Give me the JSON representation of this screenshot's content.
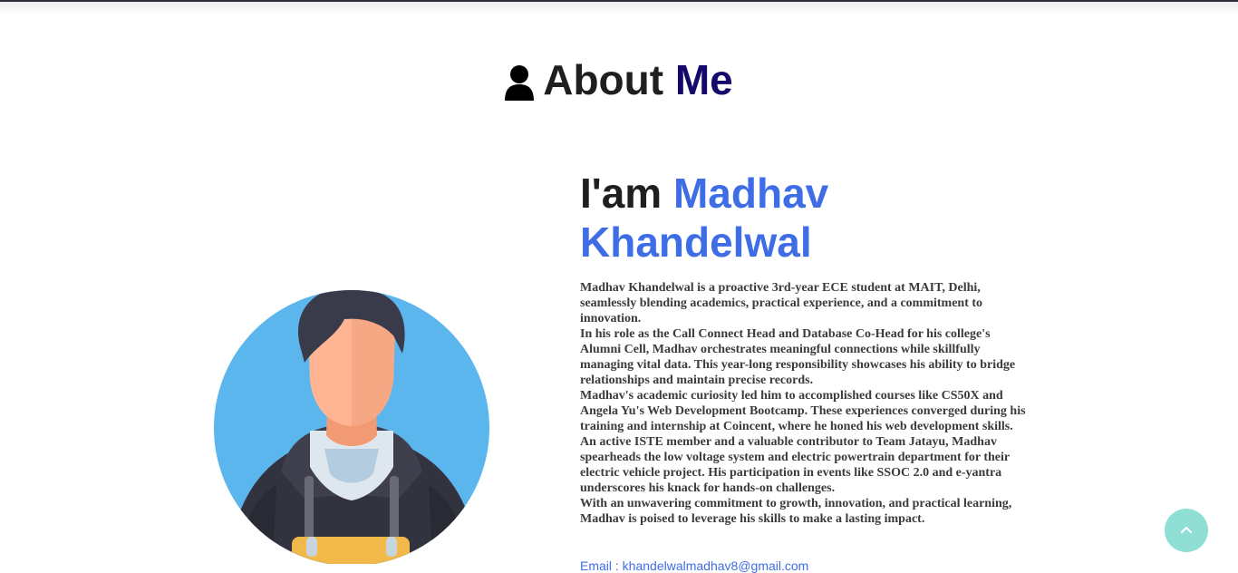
{
  "about": {
    "heading_prefix": "About",
    "heading_accent": "Me",
    "intro_prefix": "I'am",
    "name_first": "Madhav",
    "name_last": "Khandelwal",
    "bio": [
      "Madhav Khandelwal is a proactive 3rd-year ECE student at MAIT, Delhi, seamlessly blending academics, practical experience, and a commitment to innovation.",
      "In his role as the Call Connect Head and Database Co-Head for his college's Alumni Cell, Madhav orchestrates meaningful connections while skillfully managing vital data. This year-long responsibility showcases his ability to bridge relationships and maintain precise records.",
      "Madhav's academic curiosity led him to accomplished courses like CS50X and Angela Yu's Web Development Bootcamp. These experiences converged during his training and internship at Coincent, where he honed his web development skills.",
      "An active ISTE member and a valuable contributor to Team Jatayu, Madhav spearheads the low voltage system and electric powertrain department for their electric vehicle project. His participation in events like SSOC 2.0 and e-yantra underscores his knack for hands-on challenges.",
      "With an unwavering commitment to growth, innovation, and practical learning, Madhav is poised to leverage his skills to make a lasting impact."
    ],
    "read_more": "Email : khandelwalmadhav8@gmail.com"
  },
  "icons": {
    "heading": "user-icon",
    "scroll_top": "chevron-up-icon"
  },
  "colors": {
    "heading_accent": "#150a6b",
    "name": "#3e6de6",
    "scroll_button": "#8fdfd4"
  }
}
